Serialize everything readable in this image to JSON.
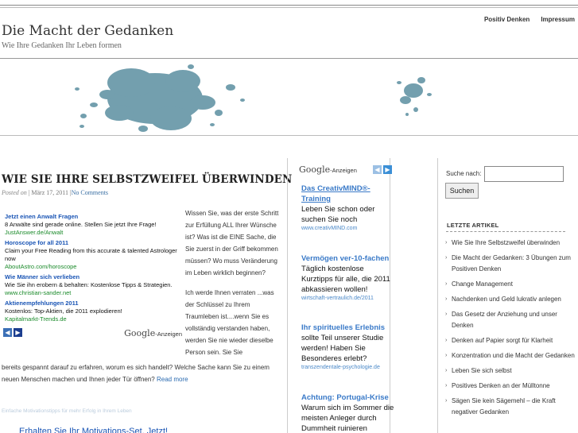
{
  "nav": {
    "items": [
      "Positiv Denken",
      "Impressum"
    ]
  },
  "site": {
    "title": "Die Macht der Gedanken",
    "tagline": "Wie Ihre Gedanken Ihr Leben formen"
  },
  "post": {
    "title": "WIE SIE IHRE SELBSTZWEIFEL ÜBERWINDEN",
    "posted_on": "Posted on",
    "date": "März 17, 2011",
    "comments": "No Comments",
    "paragraphs_right": [
      "Wissen Sie, was der erste Schritt zur Erfüllung ALL Ihrer Wünsche ist? Was ist die EINE Sache, die Sie zuerst in der Griff bekommen müssen? Wo muss Veränderung im Leben wirklich beginnen?",
      "Ich werde Ihnen verraten ...was der Schlüssel zu Ihrem Traumleben ist....wenn Sie es vollständig verstanden haben, werden Sie nie wieder dieselbe Person sein. Sie Sie"
    ],
    "paragraph_full": "bereits gespannt darauf zu erfahren, worum es sich handelt? Welche Sache kann Sie zu einem neuen Menschen machen und Ihnen jeder Tür öffnen?",
    "read_more": "Read more",
    "faint_link": "Einfache Motivationstipps für mehr Erfolg in Ihrem Leben",
    "bottom_link": "Erhalten Sie Ihr Motivations-Set. Jetzt!"
  },
  "ads_inline": {
    "items": [
      {
        "title": "Jetzt einen Anwalt Fragen",
        "text": "8 Anwälte sind gerade online. Stellen Sie jetzt Ihre Frage!",
        "url": "JustAnswer.de/Anwalt"
      },
      {
        "title": "Horoscope for all 2011",
        "text": "Claim your Free Reading from this accurate & talented Astrologer now",
        "url": "AboutAstro.com/horoscope"
      },
      {
        "title": "Wie Männer sich verlieben",
        "text": "Wie Sie ihn erobern & behalten: Kostenlose Tipps & Strategien.",
        "url": "www.christian-sander.net"
      },
      {
        "title": "Aktienempfehlungen 2011",
        "text": "Kostenlos: Top-Aktien, die 2011 explodieren!",
        "url": "Kapitalmarkt-Trends.de"
      }
    ],
    "google": "Google",
    "anzeigen": "-Anzeigen"
  },
  "ads_middle": {
    "google": "Google",
    "anzeigen": "-Anzeigen",
    "items": [
      {
        "title": "Das CreativMIND®-Training",
        "text": "Leben Sie schon oder suchen Sie noch",
        "url": "www.creativMIND.com"
      },
      {
        "title": "Vermögen ver-10-fachen",
        "text": "Täglich kostenlose Kurztipps für alle, die 2011 abkassieren wollen!",
        "url": "wirtschaft-vertraulich.de/2011"
      },
      {
        "title": "Ihr spirituelles Erlebnis",
        "text": "sollte Teil unserer Studie werden! Haben Sie Besonderes erlebt?",
        "url": "transzendentale-psychologie.de"
      },
      {
        "title": "Achtung: Portugal-Krise",
        "text": "Warum sich im Sommer die meisten Anleger durch Dummheit ruinieren",
        "url": ""
      }
    ]
  },
  "sidebar": {
    "search_label": "Suche nach:",
    "search_button": "Suchen",
    "heading": "LETZTE ARTIKEL",
    "articles": [
      "Wie Sie Ihre Selbstzweifel überwinden",
      "Die Macht der Gedanken: 3 Übungen zum Positiven Denken",
      "Change Management",
      "Nachdenken und Geld lukrativ anlegen",
      "Das Gesetz der Anziehung und unser Denken",
      "Denken auf Papier sorgt für Klarheit",
      "Konzentration und die Macht der Gedanken",
      "Leben Sie sich selbst",
      "Positives Denken an der Mülltonne",
      "Sägen Sie kein Sägemehl – die Kraft negativer Gedanken"
    ]
  },
  "colors": {
    "link": "#1a55b5",
    "ad_url": "#1a8a2a",
    "splash": "#5b8fa0"
  }
}
